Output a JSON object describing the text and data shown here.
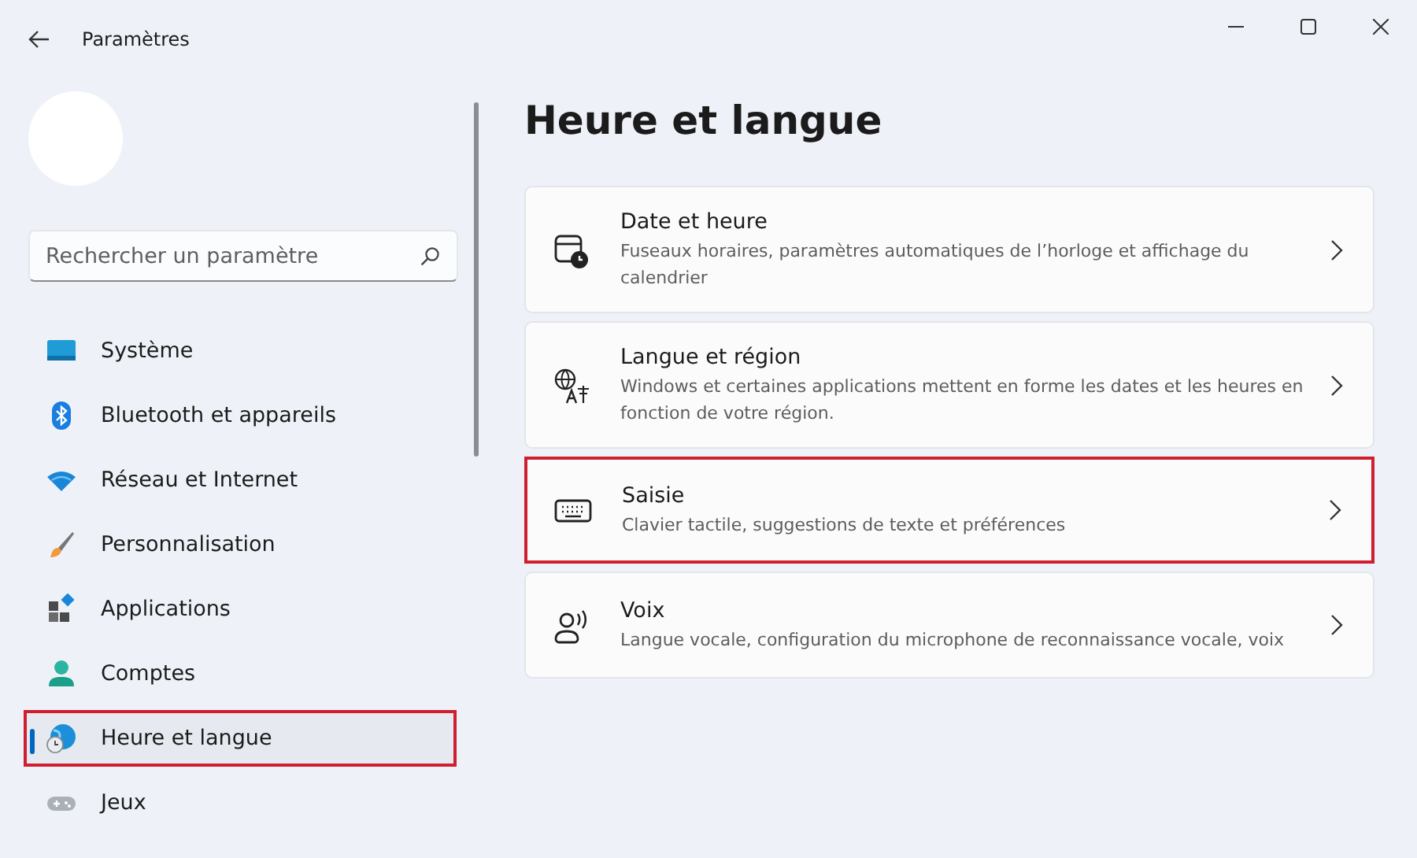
{
  "window": {
    "title": "Paramètres"
  },
  "search": {
    "placeholder": "Rechercher un paramètre"
  },
  "sidebar": {
    "items": [
      {
        "label": "Système",
        "selected": false,
        "highlighted": false
      },
      {
        "label": "Bluetooth et appareils",
        "selected": false,
        "highlighted": false
      },
      {
        "label": "Réseau et Internet",
        "selected": false,
        "highlighted": false
      },
      {
        "label": "Personnalisation",
        "selected": false,
        "highlighted": false
      },
      {
        "label": "Applications",
        "selected": false,
        "highlighted": false
      },
      {
        "label": "Comptes",
        "selected": false,
        "highlighted": false
      },
      {
        "label": "Heure et langue",
        "selected": true,
        "highlighted": true
      },
      {
        "label": "Jeux",
        "selected": false,
        "highlighted": false
      }
    ]
  },
  "page": {
    "title": "Heure et langue",
    "cards": [
      {
        "title": "Date et heure",
        "description": "Fuseaux horaires, paramètres automatiques de l’horloge et affichage du calendrier",
        "highlighted": false
      },
      {
        "title": "Langue et région",
        "description": "Windows et certaines applications mettent en forme les dates et les heures en fonction de votre région.",
        "highlighted": false
      },
      {
        "title": "Saisie",
        "description": "Clavier tactile, suggestions de texte et préférences",
        "highlighted": true
      },
      {
        "title": "Voix",
        "description": "Langue vocale, configuration du microphone de reconnaissance vocale, voix",
        "highlighted": false
      }
    ]
  }
}
